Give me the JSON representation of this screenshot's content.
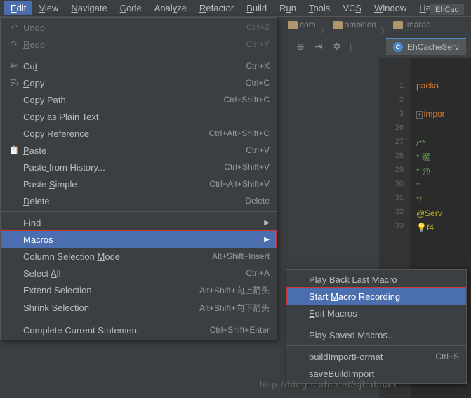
{
  "menubar": [
    "Edit",
    "View",
    "Navigate",
    "Code",
    "Analyze",
    "Refactor",
    "Build",
    "Run",
    "Tools",
    "VCS",
    "Window",
    "He"
  ],
  "menubar_mn": [
    0,
    0,
    0,
    0,
    4,
    0,
    0,
    1,
    0,
    2,
    0,
    0
  ],
  "menubar_active": 0,
  "breadcrumb": [
    "com",
    "ambition",
    "imarad"
  ],
  "tab": {
    "label": "EhCacheServ"
  },
  "code_header": "EhCac",
  "gutter": [
    "1",
    "2",
    "3",
    "26",
    "27",
    "28",
    "29",
    "30",
    "31",
    "32",
    "33"
  ],
  "code_lines": [
    {
      "t": "kw",
      "s": "packa"
    },
    {
      "t": "",
      "s": ""
    },
    {
      "t": "imp",
      "s": "impor"
    },
    {
      "t": "",
      "s": ""
    },
    {
      "t": "cmt",
      "s": "/**"
    },
    {
      "t": "cmt",
      "s": " * 缓"
    },
    {
      "t": "cmt",
      "s": " * @"
    },
    {
      "t": "cmt",
      "s": " *"
    },
    {
      "t": "cmt",
      "s": " */"
    },
    {
      "t": "ann",
      "s": "@Serv"
    },
    {
      "t": "bulb",
      "s": "@"
    }
  ],
  "edit_menu": [
    {
      "icon": "↶",
      "label": "Undo",
      "mn": 0,
      "shortcut": "Ctrl+Z",
      "disabled": true
    },
    {
      "icon": "↷",
      "label": "Redo",
      "mn": 0,
      "shortcut": "Ctrl+Y",
      "disabled": true
    },
    {
      "sep": true
    },
    {
      "icon": "✄",
      "label": "Cut",
      "mn": 2,
      "shortcut": "Ctrl+X"
    },
    {
      "icon": "⎘",
      "label": "Copy",
      "mn": 0,
      "shortcut": "Ctrl+C"
    },
    {
      "icon": "",
      "label": "Copy Path",
      "mn": -1,
      "shortcut": "Ctrl+Shift+C"
    },
    {
      "icon": "",
      "label": "Copy as Plain Text",
      "mn": -1,
      "shortcut": ""
    },
    {
      "icon": "",
      "label": "Copy Reference",
      "mn": -1,
      "shortcut": "Ctrl+Alt+Shift+C"
    },
    {
      "icon": "📋",
      "label": "Paste",
      "mn": 0,
      "shortcut": "Ctrl+V"
    },
    {
      "icon": "",
      "label": "Paste from History...",
      "mn": 5,
      "shortcut": "Ctrl+Shift+V"
    },
    {
      "icon": "",
      "label": "Paste Simple",
      "mn": 6,
      "shortcut": "Ctrl+Alt+Shift+V"
    },
    {
      "icon": "",
      "label": "Delete",
      "mn": 0,
      "shortcut": "Delete"
    },
    {
      "sep": true
    },
    {
      "icon": "",
      "label": "Find",
      "mn": 0,
      "shortcut": "",
      "arrow": true
    },
    {
      "icon": "",
      "label": "Macros",
      "mn": 0,
      "shortcut": "",
      "arrow": true,
      "hover": true,
      "redbox": true
    },
    {
      "icon": "",
      "label": "Column Selection Mode",
      "mn": 17,
      "shortcut": "Alt+Shift+Insert"
    },
    {
      "icon": "",
      "label": "Select All",
      "mn": 7,
      "shortcut": "Ctrl+A"
    },
    {
      "icon": "",
      "label": "Extend Selection",
      "mn": -1,
      "shortcut": "Alt+Shift+向上箭头"
    },
    {
      "icon": "",
      "label": "Shrink Selection",
      "mn": -1,
      "shortcut": "Alt+Shift+向下箭头"
    },
    {
      "sep": true
    },
    {
      "icon": "",
      "label": "Complete Current Statement",
      "mn": -1,
      "shortcut": "Ctrl+Shift+Enter"
    }
  ],
  "macros_menu": [
    {
      "label": "Play Back Last Macro",
      "mn": 4,
      "shortcut": ""
    },
    {
      "label": "Start Macro Recording",
      "mn": 6,
      "shortcut": "",
      "hover": true,
      "redbox": true
    },
    {
      "label": "Edit Macros",
      "mn": 0,
      "shortcut": ""
    },
    {
      "sep": true
    },
    {
      "label": "Play Saved Macros...",
      "mn": -1,
      "shortcut": ""
    },
    {
      "sep": true
    },
    {
      "label": "buildImportFormat",
      "mn": -1,
      "shortcut": "Ctrl+S"
    },
    {
      "label": "saveBuildImport",
      "mn": -1,
      "shortcut": ""
    }
  ],
  "watermark": "http://blog.csdn.net/sjhuhuan"
}
